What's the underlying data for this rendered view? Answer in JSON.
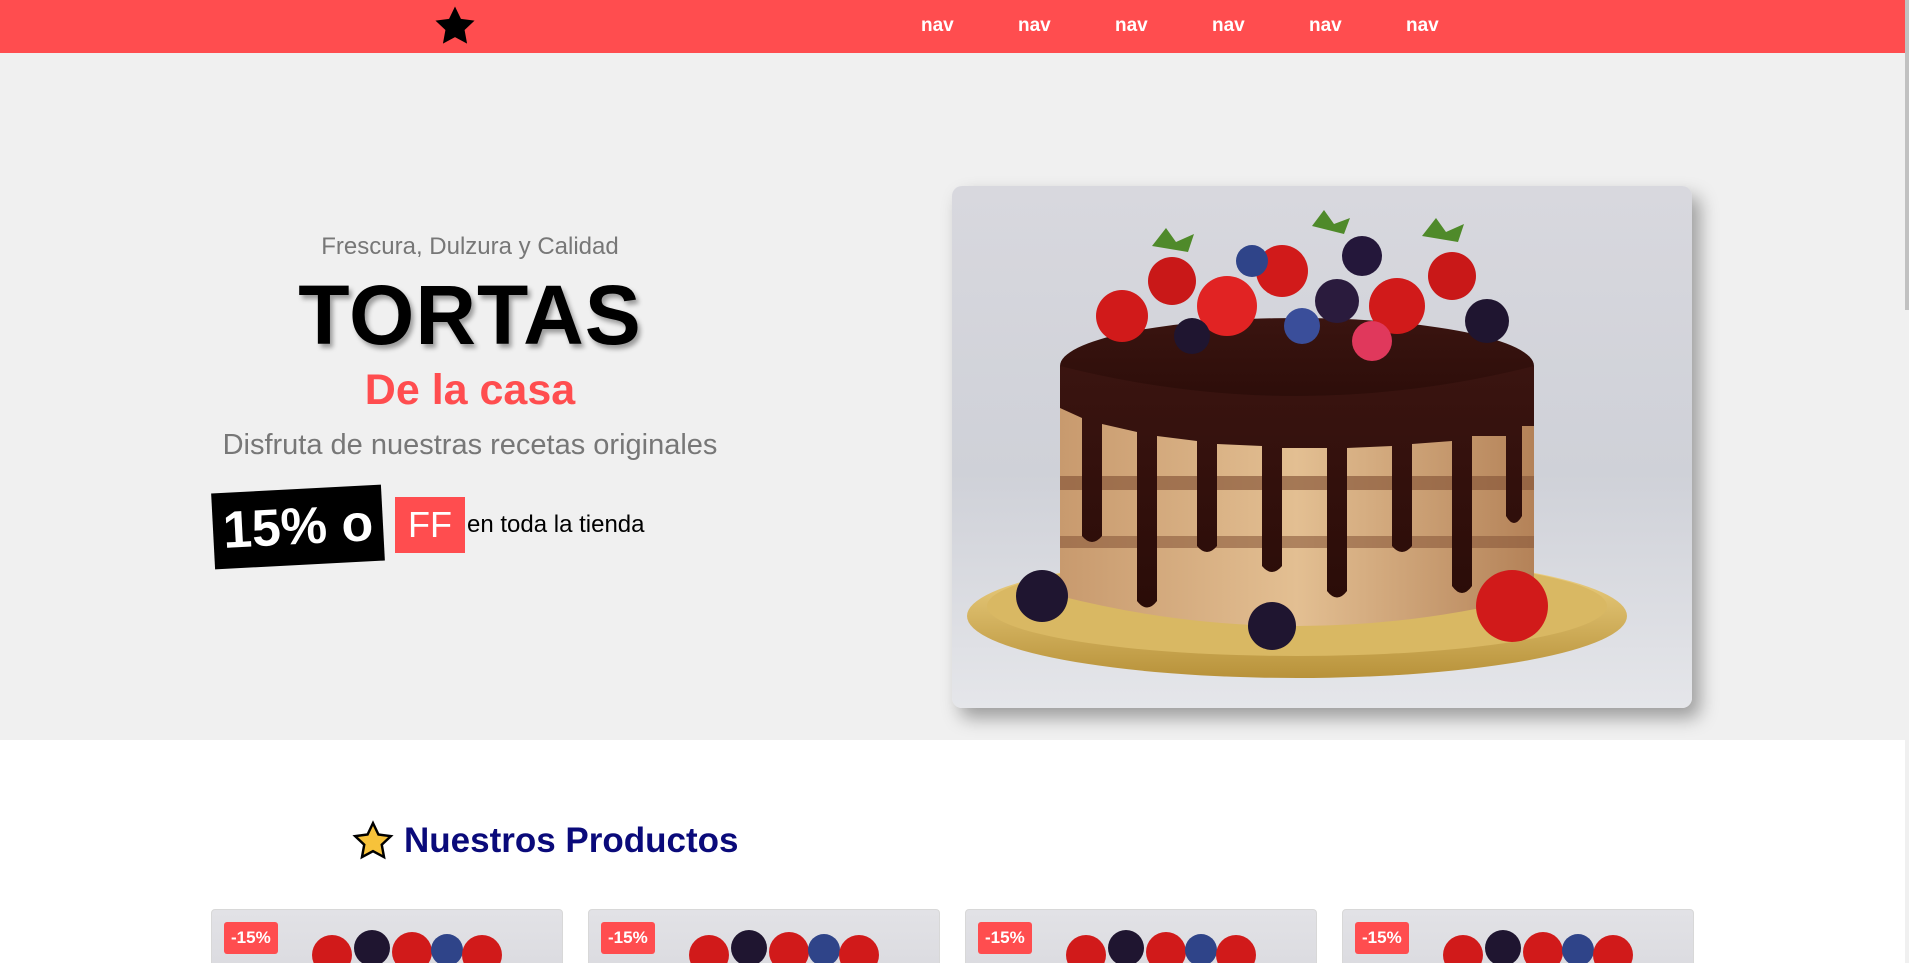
{
  "header": {
    "logo_icon": "star-icon",
    "nav_items": [
      "nav",
      "nav",
      "nav",
      "nav",
      "nav",
      "nav"
    ]
  },
  "hero": {
    "tagline": "Frescura, Dulzura y Calidad",
    "title": "TORTAS",
    "subtitle": "De la casa",
    "description": "Disfruta de nuestras recetas originales",
    "promo_percent": "15% o",
    "promo_ff": "FF",
    "promo_rest": "en toda la tienda",
    "image": "chocolate-drip-cake-with-berries"
  },
  "products": {
    "icon": "star-icon",
    "title": "Nuestros Productos",
    "cards": [
      {
        "badge": "-15%"
      },
      {
        "badge": "-15%"
      },
      {
        "badge": "-15%"
      },
      {
        "badge": "-15%"
      }
    ]
  },
  "colors": {
    "accent": "#ff4d4f",
    "hero_bg": "#f0f0f0",
    "products_title": "#0a0a7a"
  }
}
